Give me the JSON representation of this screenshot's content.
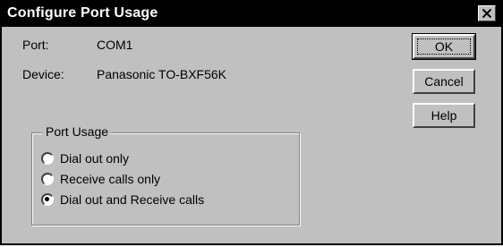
{
  "window": {
    "title": "Configure Port Usage",
    "close_icon": "close-icon"
  },
  "info": {
    "port_label": "Port:",
    "port_value": "COM1",
    "device_label": "Device:",
    "device_value": "Panasonic TO-BXF56K"
  },
  "group": {
    "title": "Port Usage",
    "options": [
      {
        "label": "Dial out only",
        "selected": false
      },
      {
        "label": "Receive calls only",
        "selected": false
      },
      {
        "label": "Dial out and Receive calls",
        "selected": true
      }
    ]
  },
  "buttons": {
    "ok": "OK",
    "cancel": "Cancel",
    "help": "Help"
  }
}
